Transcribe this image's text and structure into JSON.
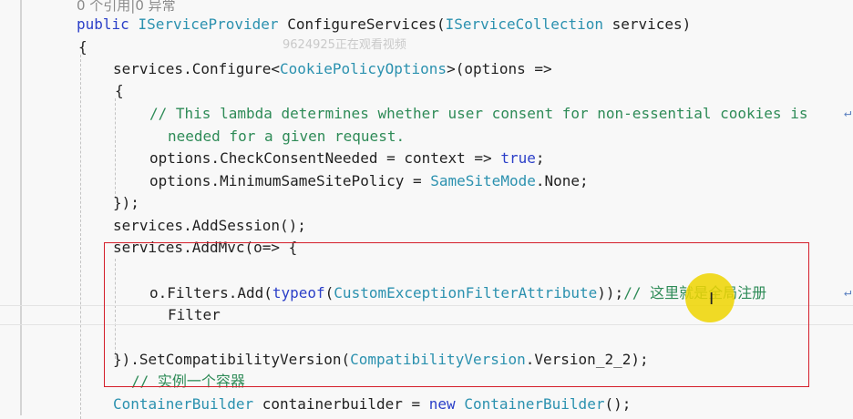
{
  "code_lens": "0 个引用|0 异常",
  "watermark": "9624925正在观看视频",
  "lines": {
    "l1": {
      "kw": "public",
      "ty1": "IServiceProvider",
      "mid": " ConfigureServices(",
      "ty2": "IServiceCollection",
      "end": " services)"
    },
    "l2": "{",
    "l3": {
      "pre": "services.Configure<",
      "ty": "CookiePolicyOptions",
      "post": ">(options =>"
    },
    "l4": "{",
    "l5": "// This lambda determines whether user consent for non-essential cookies is",
    "l6": "needed for a given request.",
    "l7": {
      "pre": "options.CheckConsentNeeded = context => ",
      "kw": "true",
      "post": ";"
    },
    "l8": {
      "pre": "options.MinimumSameSitePolicy = ",
      "ty": "SameSiteMode",
      "post": ".None;"
    },
    "l9": "});",
    "l10": "services.AddSession();",
    "l11": "services.AddMvc(o=> {",
    "l13": {
      "pre": "o.Filters.Add(",
      "kw": "typeof",
      "mid": "(",
      "ty": "CustomExceptionFilterAttribute",
      "post": "));",
      "cm": "// 这里就是全局注册"
    },
    "l14": "Filter",
    "l16": {
      "pre": "}).SetCompatibilityVersion(",
      "ty": "CompatibilityVersion",
      "post": ".Version_2_2);"
    },
    "l17": "// 实例一个容器",
    "l18": {
      "ty1": "ContainerBuilder",
      "mid": " containerbuilder = ",
      "kw": "new",
      "sp": " ",
      "ty2": "ContainerBuilder",
      "post": "();"
    }
  },
  "wrap_glyph": "↵",
  "cursor_glyph": "I",
  "colors": {
    "keyword": "#2b3fc8",
    "type": "#2b91af",
    "comment": "#2e8b57",
    "highlight_box": "#d41f2b",
    "cursor_dot": "#eed500"
  }
}
